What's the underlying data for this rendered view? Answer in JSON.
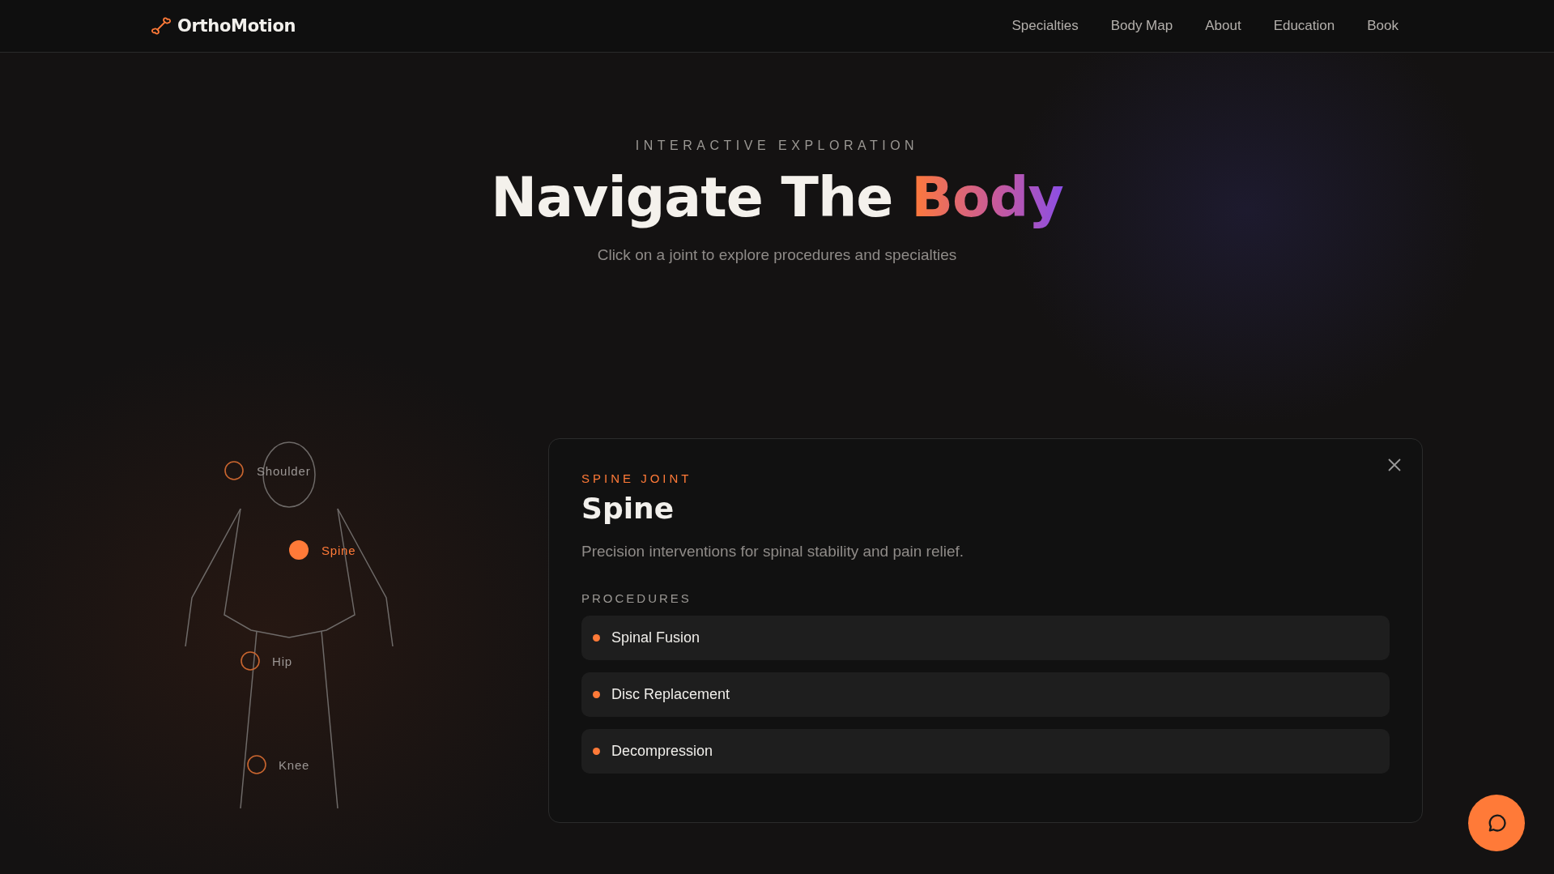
{
  "nav": {
    "brand": "OrthoMotion",
    "links": [
      "Specialties",
      "Body Map",
      "About",
      "Education",
      "Book"
    ]
  },
  "hero": {
    "eyebrow": "INTERACTIVE EXPLORATION",
    "title": "Navigate The",
    "title_accent": "Body",
    "subtitle": "Click on a joint to explore procedures and specialties"
  },
  "joints": [
    {
      "name": "Shoulder",
      "selected": false
    },
    {
      "name": "Spine",
      "selected": true
    },
    {
      "name": "Hip",
      "selected": false
    },
    {
      "name": "Knee",
      "selected": false
    }
  ],
  "detail": {
    "eyebrow": "SPINE JOINT",
    "title": "Spine",
    "description": "Precision interventions for spinal stability and pain relief.",
    "procedures_label": "PROCEDURES",
    "procedures": [
      "Spinal Fusion",
      "Disc Replacement",
      "Decompression"
    ]
  }
}
